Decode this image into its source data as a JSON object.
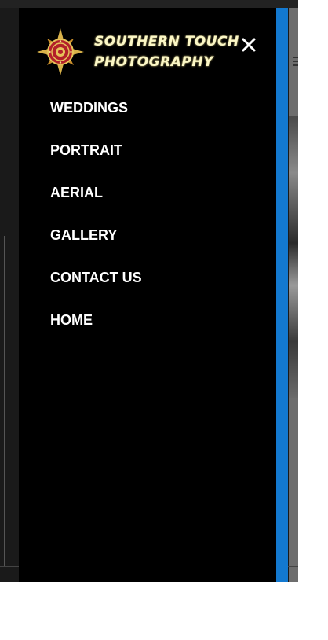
{
  "brand": {
    "line1": "SOUTHERN TOUCH",
    "line2": "PHOTOGRAPHY",
    "emblem_icon": "compass-rose-emblem-icon",
    "text_color": "#fbf7c6"
  },
  "drawer": {
    "close_icon": "close-icon",
    "accent_color": "#1379d0",
    "background_color": "#000000"
  },
  "menu": {
    "items": [
      {
        "label": "WEDDINGS"
      },
      {
        "label": "PORTRAIT"
      },
      {
        "label": "AERIAL"
      },
      {
        "label": "GALLERY"
      },
      {
        "label": "CONTACT US"
      },
      {
        "label": "HOME"
      }
    ]
  }
}
